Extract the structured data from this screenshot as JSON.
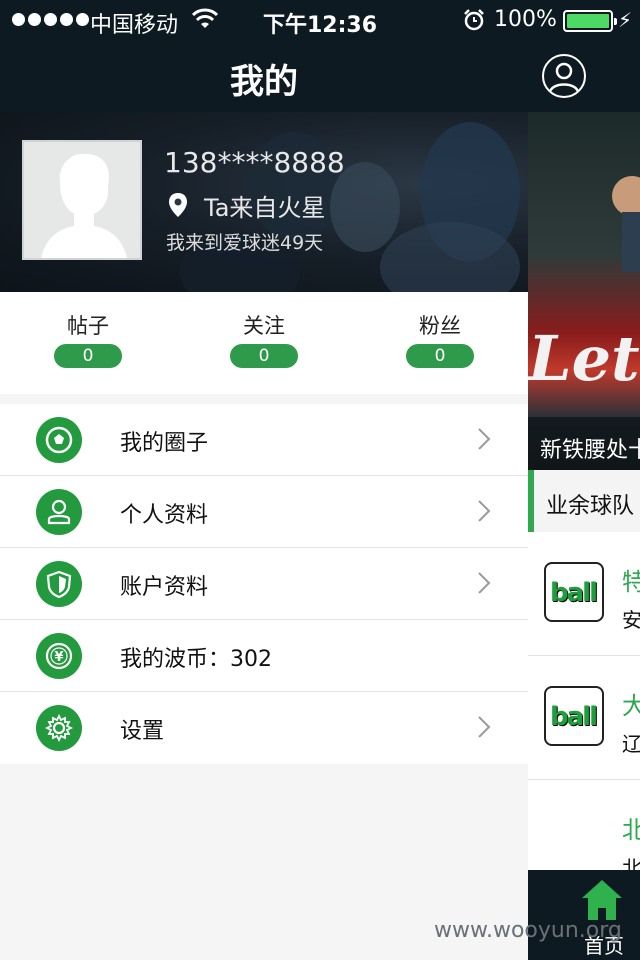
{
  "status_bar": {
    "carrier": "中国移动",
    "time": "下午12:36",
    "battery_percent": "100%",
    "battery_level": 1.0,
    "signal_dots": 5,
    "icons": [
      "signal-dots-icon",
      "wifi-icon",
      "alarm-icon",
      "battery-icon",
      "charging-bolt-icon"
    ]
  },
  "nav": {
    "title": "我的",
    "right_icon": "user-circle-icon"
  },
  "profile": {
    "phone": "138****8888",
    "location": "Ta来自火星",
    "days_text": "我来到爱球迷49天",
    "avatar_icon": "default-avatar-icon",
    "location_icon": "map-pin-icon"
  },
  "stats": [
    {
      "label": "帖子",
      "value": "0"
    },
    {
      "label": "关注",
      "value": "0"
    },
    {
      "label": "粉丝",
      "value": "0"
    }
  ],
  "menu": [
    {
      "label": "我的圈子",
      "icon": "soccer-ball-icon",
      "has_chevron": true
    },
    {
      "label": "个人资料",
      "icon": "person-icon",
      "has_chevron": true
    },
    {
      "label": "账户资料",
      "icon": "shield-icon",
      "has_chevron": true
    },
    {
      "label": "我的波币：302",
      "icon": "yuan-coin-icon",
      "has_chevron": false
    },
    {
      "label": "设置",
      "icon": "gear-icon",
      "has_chevron": true
    }
  ],
  "background_page": {
    "banner_text": "新铁腰处十",
    "section_title": "业余球队",
    "teams": [
      {
        "name": "特",
        "sub": "安"
      },
      {
        "name": "大",
        "sub": "辽"
      },
      {
        "name": "北",
        "sub": "北"
      }
    ],
    "team_logo_text": "ball",
    "tab_label": "首页",
    "tab_icon": "home-icon"
  },
  "watermark": "www.wooyun.org",
  "colors": {
    "accent_green": "#239a3e",
    "pill_green": "#2f9a4c",
    "nav_bg": "#0e1a22",
    "battery_green": "#4cd964"
  }
}
